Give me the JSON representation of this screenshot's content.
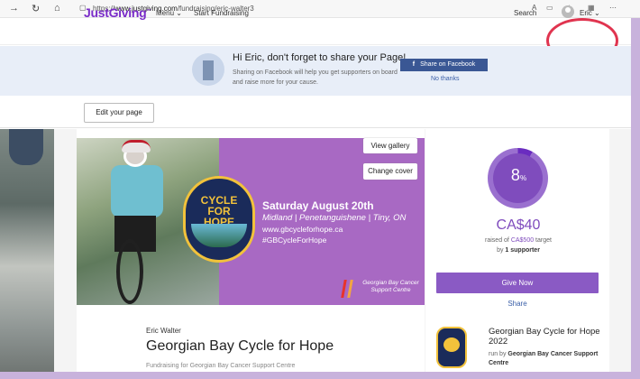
{
  "browser": {
    "back_icon": "→",
    "reload_icon": "↻",
    "home_icon": "⌂",
    "url_prefix": "https://",
    "url_domain": "www.justgiving.com",
    "url_path": "/fundraising/eric-walter3"
  },
  "header": {
    "logo": "JustGiving",
    "menu": "Menu",
    "start_fundraising": "Start Fundraising",
    "search": "Search",
    "user": "Eric",
    "chevron": "⌄"
  },
  "share_banner": {
    "title": "Hi Eric, don't forget to share your Page!",
    "body": "Sharing on Facebook will help you get supporters on board and raise more for your cause.",
    "facebook_button": "Share on Facebook",
    "facebook_glyph": "f",
    "no_thanks": "No thanks"
  },
  "edit_bar": {
    "edit_page": "Edit your page"
  },
  "cover": {
    "view_gallery": "View gallery",
    "change_cover": "Change cover",
    "badge_text": "CYCLE FOR HOPE",
    "date": "Saturday August 20th",
    "locations": "Midland | Penetanguishene | Tiny, ON",
    "url": "www.gbcycleforhope.ca",
    "hashtag": "#GBCycleForHope",
    "org_logo_text": "Georgian Bay Cancer Support Centre"
  },
  "progress": {
    "percent": "8",
    "percent_sign": "%",
    "percent_value": 0.08,
    "raised": "CA$40",
    "target_prefix": "raised of ",
    "target_amount": "CA$500",
    "target_suffix": " target",
    "supporters_prefix": "by ",
    "supporters_count": "1 supporter",
    "give_now": "Give Now",
    "share": "Share"
  },
  "page_info": {
    "owner": "Eric Walter",
    "title": "Georgian Bay Cycle for Hope",
    "fundraising_for": "Fundraising for Georgian Bay Cancer Support Centre"
  },
  "event": {
    "name": "Georgian Bay Cycle for Hope 2022",
    "run_by_prefix": "run by ",
    "run_by": "Georgian Bay Cancer Support Centre"
  },
  "colors": {
    "brand_purple": "#7a2cc9",
    "facebook_blue": "#3a5794",
    "highlight_red": "#e0344f"
  }
}
